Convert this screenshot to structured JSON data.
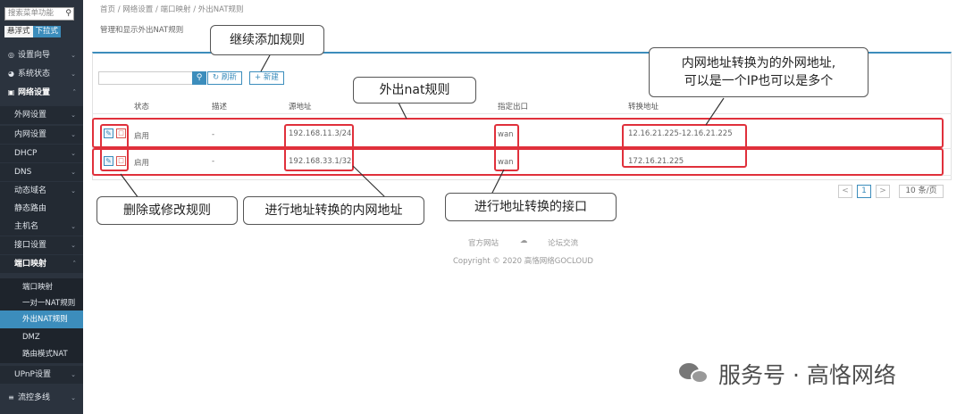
{
  "sidebar": {
    "search_placeholder": "搜索菜单功能",
    "mode_float": "悬浮式",
    "mode_dropdown": "下拉式",
    "items": {
      "wizard": "设置向导",
      "status": "系统状态",
      "network": "网络设置",
      "wan": "外网设置",
      "lan": "内网设置",
      "dhcp": "DHCP",
      "dns": "DNS",
      "ddns": "动态域名",
      "static_route": "静态路由",
      "hostname": "主机名",
      "iface": "接口设置",
      "portmap": "端口映射",
      "portmap_sub": "端口映射",
      "one_to_one": "一对一NAT规则",
      "snat": "外出NAT规则",
      "dmz": "DMZ",
      "router_nat": "路由模式NAT",
      "upnp": "UPnP设置",
      "flow": "流控多线"
    }
  },
  "breadcrumb": "首页 / 网络设置 / 端口映射 / 外出NAT规则",
  "page_subtitle": "管理和显示外出NAT规则",
  "toolbar": {
    "refresh": "刷新",
    "add": "新建"
  },
  "table": {
    "headers": {
      "status": "状态",
      "desc": "描述",
      "source": "源地址",
      "outif": "指定出口",
      "translated": "转换地址"
    },
    "rows": [
      {
        "status": "启用",
        "desc": "-",
        "source": "192.168.11.3/24",
        "outif": "wan",
        "translated": "12.16.21.225-12.16.21.225"
      },
      {
        "status": "启用",
        "desc": "-",
        "source": "192.168.33.1/32",
        "outif": "wan",
        "translated": "172.16.21.225"
      }
    ]
  },
  "pager": {
    "prev": "<",
    "page": "1",
    "next": ">",
    "size": "10 条/页"
  },
  "footer": {
    "site": "官方网站",
    "forum": "论坛交流",
    "copyright": "Copyright © 2020 高恪网络GOCLOUD"
  },
  "callouts": {
    "add_more": "继续添加规则",
    "outbound": "外出nat规则",
    "translated_line1": "内网地址转换为的外网地址,",
    "translated_line2": "可以是一个IP也可以是多个",
    "edit_delete": "删除或修改规则",
    "inner_addr": "进行地址转换的内网地址",
    "iface": "进行地址转换的接口"
  },
  "watermark": "服务号 · 高恪网络",
  "colors": {
    "accent": "#3c8dbc",
    "sidebar": "#2b333e",
    "highlight": "#e0303b"
  }
}
